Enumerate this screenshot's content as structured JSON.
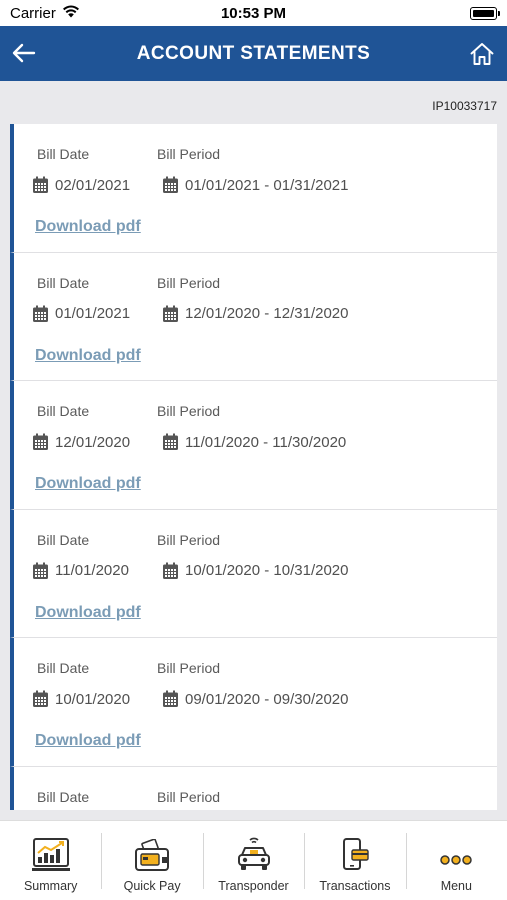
{
  "status_bar": {
    "carrier": "Carrier",
    "time": "10:53 PM"
  },
  "header": {
    "title": "ACCOUNT STATEMENTS",
    "back_icon": "arrow-left-icon",
    "home_icon": "home-icon"
  },
  "account_id": "IP10033717",
  "statements": [
    {
      "bill_date_label": "Bill Date",
      "bill_period_label": "Bill Period",
      "bill_date": "02/01/2021",
      "bill_period": "01/01/2021 - 01/31/2021",
      "download_label": "Download pdf"
    },
    {
      "bill_date_label": "Bill Date",
      "bill_period_label": "Bill Period",
      "bill_date": "01/01/2021",
      "bill_period": "12/01/2020 - 12/31/2020",
      "download_label": "Download pdf"
    },
    {
      "bill_date_label": "Bill Date",
      "bill_period_label": "Bill Period",
      "bill_date": "12/01/2020",
      "bill_period": "11/01/2020 - 11/30/2020",
      "download_label": "Download pdf"
    },
    {
      "bill_date_label": "Bill Date",
      "bill_period_label": "Bill Period",
      "bill_date": "11/01/2020",
      "bill_period": "10/01/2020 - 10/31/2020",
      "download_label": "Download pdf"
    },
    {
      "bill_date_label": "Bill Date",
      "bill_period_label": "Bill Period",
      "bill_date": "10/01/2020",
      "bill_period": "09/01/2020 - 09/30/2020",
      "download_label": "Download pdf"
    },
    {
      "bill_date_label": "Bill Date",
      "bill_period_label": "Bill Period"
    }
  ],
  "tabbar": {
    "items": [
      {
        "label": "Summary",
        "icon": "chart-icon"
      },
      {
        "label": "Quick Pay",
        "icon": "wallet-icon"
      },
      {
        "label": "Transponder",
        "icon": "car-transponder-icon"
      },
      {
        "label": "Transactions",
        "icon": "phone-card-icon"
      },
      {
        "label": "Menu",
        "icon": "more-dots-icon"
      }
    ]
  },
  "colors": {
    "brand": "#1f5496",
    "link": "#7b9cb6",
    "accent_yellow": "#f2b01e"
  }
}
